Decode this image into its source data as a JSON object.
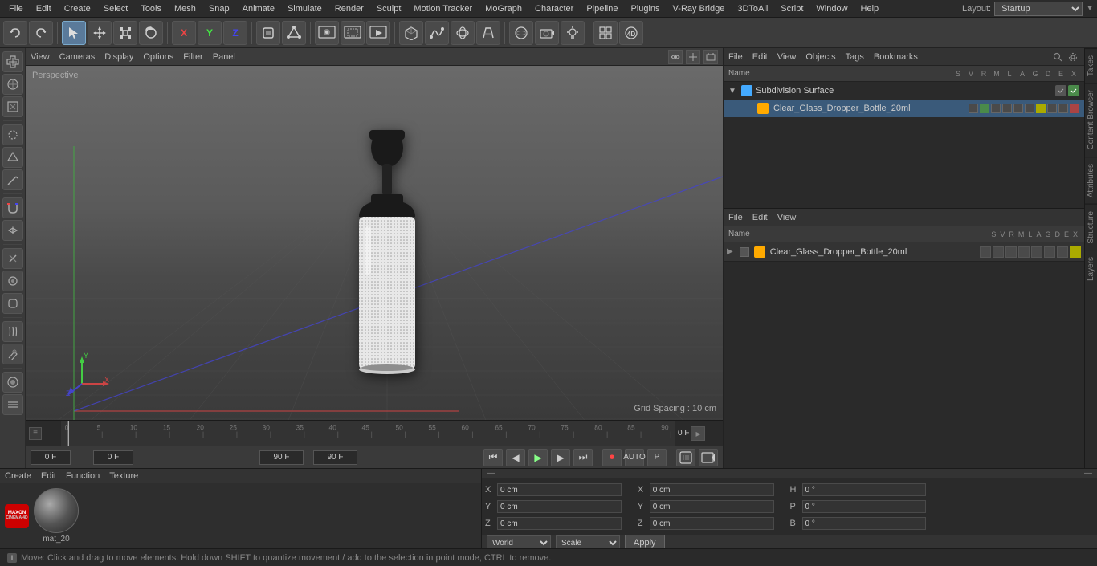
{
  "menu": {
    "items": [
      "File",
      "Edit",
      "Create",
      "Select",
      "Tools",
      "Mesh",
      "Snap",
      "Animate",
      "Simulate",
      "Render",
      "Sculpt",
      "Motion Tracker",
      "MoGraph",
      "Character",
      "Pipeline",
      "Plugins",
      "V-Ray Bridge",
      "3DToAll",
      "Script",
      "Window",
      "Help"
    ]
  },
  "layout": {
    "label": "Layout:",
    "selected": "Startup"
  },
  "toolbar": {
    "undo_label": "↩",
    "redo_label": "↪"
  },
  "viewport": {
    "perspective_label": "Perspective",
    "grid_spacing_label": "Grid Spacing : 10 cm",
    "menus": [
      "View",
      "Cameras",
      "Display",
      "Options",
      "Filter",
      "Panel"
    ]
  },
  "object_manager": {
    "title": "Objects",
    "menus": [
      "File",
      "Edit",
      "View",
      "Objects",
      "Tags",
      "Bookmarks"
    ],
    "objects": [
      {
        "name": "Subdivision Surface",
        "icon_color": "#44aaff",
        "indent": 0,
        "has_children": true
      },
      {
        "name": "Clear_Glass_Dropper_Bottle_20ml",
        "icon_color": "#ffaa00",
        "indent": 1,
        "has_children": false
      }
    ]
  },
  "attributes_panel": {
    "menus": [
      "File",
      "Edit",
      "View"
    ],
    "tabs": [
      "S",
      "V",
      "R",
      "M",
      "L",
      "A",
      "G",
      "D",
      "E",
      "X"
    ],
    "selected_object": "Clear_Glass_Dropper_Bottle_20ml",
    "icon_color": "#ffaa00",
    "col_headers": [
      "S",
      "V",
      "R",
      "M",
      "L",
      "A",
      "G",
      "D",
      "E",
      "X"
    ]
  },
  "timeline": {
    "markers": [
      0,
      5,
      10,
      15,
      20,
      25,
      30,
      35,
      40,
      45,
      50,
      55,
      60,
      65,
      70,
      75,
      80,
      85,
      90
    ],
    "current_frame": "0 F",
    "start_frame": "0 F",
    "end_frame": "90 F",
    "preview_end": "90 F"
  },
  "transport": {
    "frame_start": "0 F",
    "frame_from": "0 F",
    "frame_to": "90 F",
    "frame_preview": "90 F"
  },
  "material_panel": {
    "menus": [
      "Create",
      "Edit",
      "Function",
      "Texture"
    ],
    "material_name": "mat_20"
  },
  "coordinates": {
    "x_pos": "0 cm",
    "y_pos": "0 cm",
    "z_pos": "0 cm",
    "x_size": "0 cm",
    "y_size": "0 cm",
    "z_size": "0 cm",
    "h_rot": "0 °",
    "p_rot": "0 °",
    "b_rot": "0 °",
    "coord_system": "World",
    "transform_mode": "Scale",
    "apply_label": "Apply"
  },
  "status_bar": {
    "message": "Move: Click and drag to move elements. Hold down SHIFT to quantize movement / add to the selection in point mode, CTRL to remove."
  },
  "icons": {
    "play": "▶",
    "pause": "⏸",
    "stop": "⏹",
    "prev": "⏮",
    "next": "⏭",
    "prev_frame": "◀",
    "next_frame": "▶",
    "record": "⏺",
    "rewind": "⏪",
    "forward": "⏩",
    "loop": "🔁",
    "expand": "▼",
    "collapse": "▶",
    "chevron_right": "❯",
    "dot": "●",
    "grid": "⊞",
    "move": "✛",
    "rotate": "↻",
    "scale": "⤡",
    "select": "↖",
    "render": "📷",
    "camera": "🎥",
    "light": "💡",
    "checkmark": "✓",
    "x_mark": "✕",
    "search": "🔍",
    "lock": "🔒",
    "eye": "👁",
    "layers": "≡"
  },
  "right_vtabs": [
    "Takes",
    "Content Browser",
    "Attributes",
    "Structure",
    "Layer",
    "Layers"
  ]
}
